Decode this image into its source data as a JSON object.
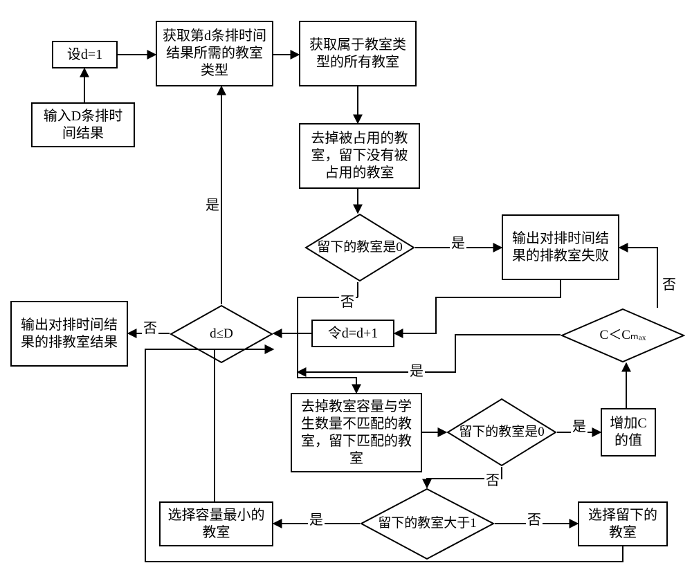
{
  "nodes": {
    "set_d1": "设d=1",
    "input_D": "输入D条排时间结果",
    "get_type": "获取第d条排时间结果所需的教室类型",
    "get_rooms": "获取属于教室类型的所有教室",
    "remove_occ": "去掉被占用的教室，留下没有被占用的教室",
    "remain0_a": "留下的教室是0",
    "fail_out": "输出对排时间结果的排教室失败",
    "d_le_D": "d≤D",
    "out_result": "输出对排时间结果的排教室结果",
    "inc_d": "令d=d+1",
    "c_lt_cmax": "C＜Cₘₐₓ",
    "filter_cap": "去掉教室容量与学生数量不匹配的教室，留下匹配的教室",
    "remain0_b": "留下的教室是0",
    "inc_C": "增加C的值",
    "remain_gt1": "留下的教室大于1",
    "choose_min": "选择容量最小的教室",
    "choose_left": "选择留下的教室"
  },
  "labels": {
    "yes": "是",
    "no": "否"
  }
}
